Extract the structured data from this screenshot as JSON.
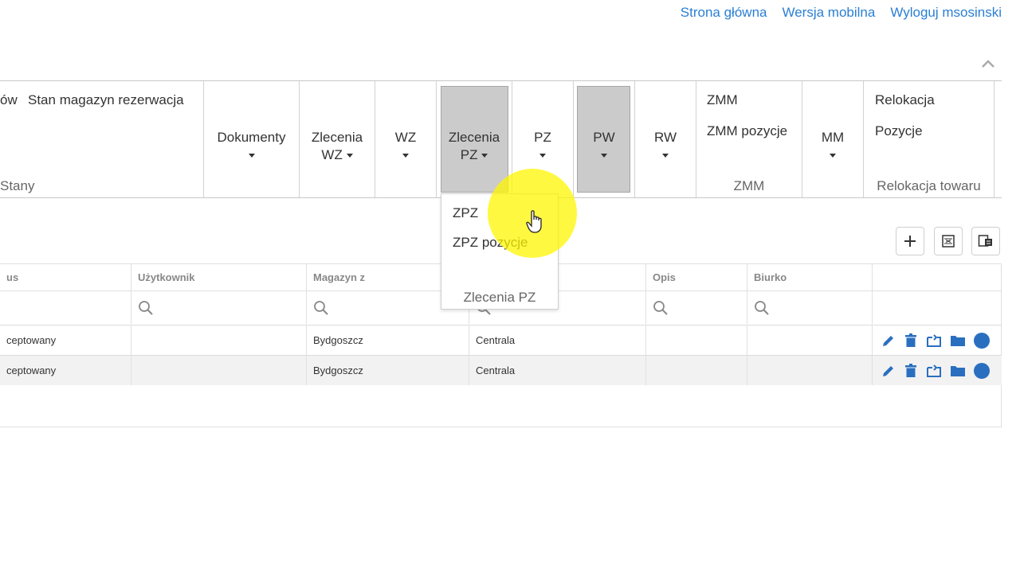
{
  "top_links": [
    "Strona główna",
    "Wersja mobilna",
    "Wyloguj msosinski"
  ],
  "ribbon": {
    "stany_partial_left": "ów",
    "stan_magazyn_rezerwacja": "Stan magazyn rezerwacja",
    "stany_caption": "Stany",
    "dokumenty": "Dokumenty",
    "zlecenia_wz_line1": "Zlecenia",
    "zlecenia_wz_line2": "WZ",
    "wz": "WZ",
    "zlecenia_pz_line1": "Zlecenia",
    "zlecenia_pz_line2": "PZ",
    "pz": "PZ",
    "pw": "PW",
    "rw": "RW",
    "zmm": "ZMM",
    "zmm_pozycje": "ZMM pozycje",
    "zmm_caption": "ZMM",
    "mm": "MM",
    "relokacja": "Relokacja",
    "pozycje": "Pozycje",
    "relokacja_caption": "Relokacja towaru"
  },
  "dropdown": {
    "items": [
      "ZPZ",
      "ZPZ pozycje"
    ],
    "caption": "Zlecenia PZ"
  },
  "grid": {
    "columns": [
      "us",
      "Użytkownik",
      "Magazyn z",
      "",
      "Opis",
      "Biurko",
      ""
    ],
    "rows": [
      {
        "status": "ceptowany",
        "uzytkownik": "",
        "magazyn_z": "Bydgoszcz",
        "magazyn_do": "Centrala",
        "opis": "",
        "biurko": ""
      },
      {
        "status": "ceptowany",
        "uzytkownik": "",
        "magazyn_z": "Bydgoszcz",
        "magazyn_do": "Centrala",
        "opis": "",
        "biurko": ""
      }
    ]
  },
  "colors": {
    "link": "#2a7fd4",
    "action_icon": "#2a6fbf",
    "highlight": "#fff500",
    "selected": "#cbcbcb"
  }
}
